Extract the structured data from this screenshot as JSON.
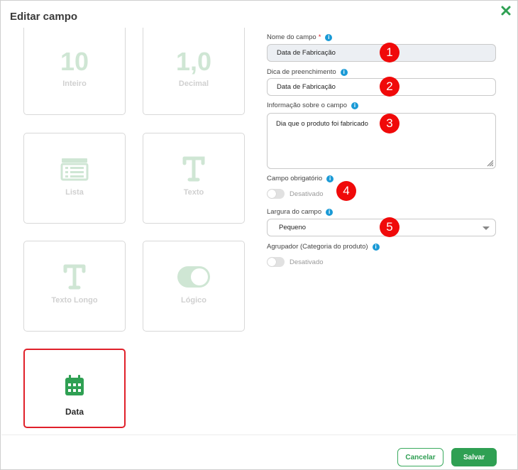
{
  "modal": {
    "title": "Editar campo",
    "close_icon": "close-x-icon"
  },
  "types": [
    {
      "big": "10",
      "label": "Inteiro"
    },
    {
      "big": "1,0",
      "label": "Decimal"
    },
    {
      "icon": "list-icon",
      "label": "Lista"
    },
    {
      "icon": "text-t-icon",
      "label": "Texto"
    },
    {
      "icon": "text-t-icon",
      "label": "Texto Longo"
    },
    {
      "icon": "toggle-icon",
      "label": "Lógico"
    },
    {
      "icon": "calendar-icon",
      "label": "Data",
      "selected": true
    }
  ],
  "form": {
    "field_name": {
      "label": "Nome do campo",
      "required_mark": "*",
      "value": "Data de Fabricação"
    },
    "fill_hint": {
      "label": "Dica de preenchimento",
      "value": "Data de Fabricação"
    },
    "field_info": {
      "label": "Informação sobre o campo",
      "value": "Dia que o produto foi fabricado"
    },
    "required_field": {
      "label": "Campo obrigatório",
      "state_text": "Desativado"
    },
    "field_width": {
      "label": "Largura do campo",
      "value": "Pequeno"
    },
    "grouper": {
      "label": "Agrupador (Categoria do produto)",
      "state_text": "Desativado"
    }
  },
  "markers": [
    "1",
    "2",
    "3",
    "4",
    "5"
  ],
  "footer": {
    "cancel_label": "Cancelar",
    "save_label": "Salvar"
  },
  "colors": {
    "accent": "#2fa053",
    "highlight": "#e0202a",
    "info": "#1a9ad6"
  }
}
